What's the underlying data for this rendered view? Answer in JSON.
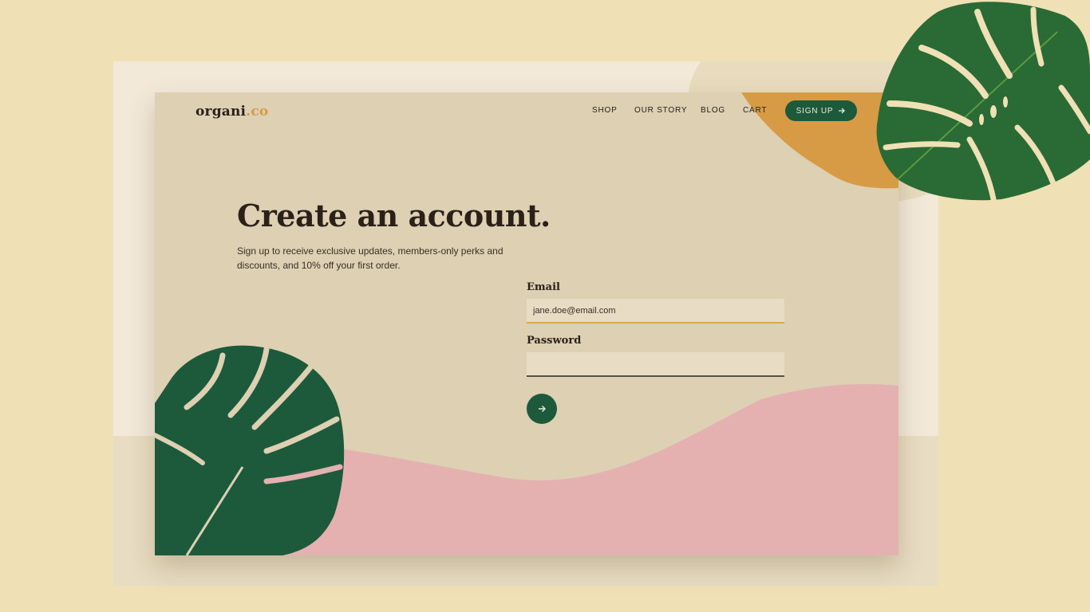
{
  "brand": {
    "name": "organi",
    "accent": ".co"
  },
  "nav": {
    "shop": "SHOP",
    "story": "OUR STORY",
    "blog": "BLOG",
    "cart": "CART",
    "signup": "SIGN UP"
  },
  "hero": {
    "title": "Create an account.",
    "subtitle": "Sign up to receive exclusive updates, members-only perks and discounts, and 10% off your first order."
  },
  "form": {
    "email_label": "Email",
    "email_value": "jane.doe@email.com",
    "password_label": "Password",
    "password_value": ""
  },
  "icons": {
    "signup_arrow": "arrow-right-icon",
    "submit_arrow": "arrow-right-icon",
    "leaf": "monstera-leaf"
  },
  "colors": {
    "background": "#efe1b5",
    "card": "#ddd0b3",
    "brand_green": "#1c5a3b",
    "accent_orange": "#d89b45",
    "pink": "#e4b1b0",
    "text": "#2b2118"
  }
}
